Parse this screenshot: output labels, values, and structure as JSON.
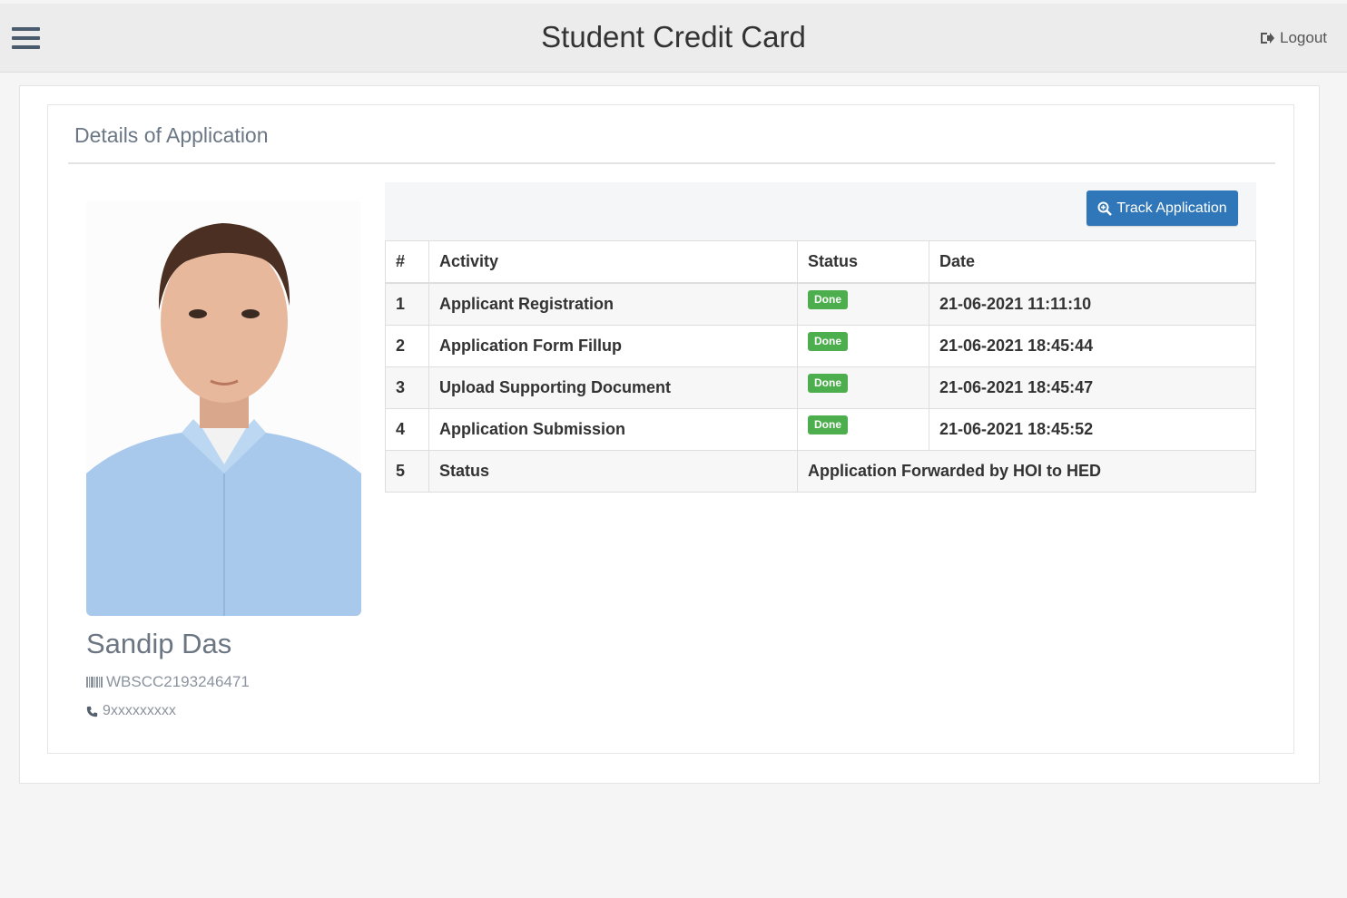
{
  "header": {
    "title": "Student Credit Card",
    "logout_label": "Logout"
  },
  "panel": {
    "title": "Details of Application"
  },
  "student": {
    "name": "Sandip Das",
    "id": "WBSCC2193246471",
    "phone": "9xxxxxxxxx"
  },
  "track_button_label": "Track Application",
  "table": {
    "headers": [
      "#",
      "Activity",
      "Status",
      "Date"
    ],
    "rows": [
      {
        "num": "1",
        "activity": "Applicant Registration",
        "status": "Done",
        "date": "21-06-2021 11:11:10"
      },
      {
        "num": "2",
        "activity": "Application Form Fillup",
        "status": "Done",
        "date": "21-06-2021 18:45:44"
      },
      {
        "num": "3",
        "activity": "Upload Supporting Document",
        "status": "Done",
        "date": "21-06-2021 18:45:47"
      },
      {
        "num": "4",
        "activity": "Application Submission",
        "status": "Done",
        "date": "21-06-2021 18:45:52"
      }
    ],
    "final_row": {
      "num": "5",
      "activity": "Status",
      "value": "Application Forwarded by HOI to HED"
    }
  },
  "colors": {
    "primary": "#2f77b9",
    "success": "#4cae4c",
    "header_bg": "#ececec"
  },
  "icons": {
    "menu": "hamburger-menu-icon",
    "logout": "sign-out-icon",
    "track": "search-plus-icon",
    "id": "barcode-icon",
    "phone": "phone-icon"
  }
}
